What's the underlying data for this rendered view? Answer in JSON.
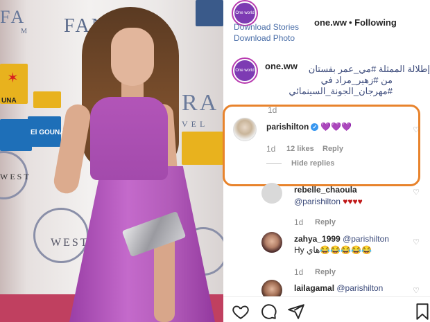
{
  "post": {
    "account": {
      "avatar_text": "One world",
      "username": "one.ww",
      "following": "• Following",
      "links": [
        "Download Stories",
        "Download Photo"
      ]
    },
    "caption": {
      "username": "one.ww",
      "text_line1": "إطلالة الممثلة #مي_عمر بفستان",
      "text_line2": "من #زهير_مراد في",
      "text_line3": "#مهرجان_الجونة_السينمائي",
      "time": "1d"
    },
    "backdrop": {
      "fan": "FANAR",
      "ma": "MA",
      "fa": "FA",
      "m": "M",
      "ra": "RA",
      "vel": "VEL",
      "west1": "WEST",
      "west2": "WEST",
      "logo_word1": "UNA",
      "logo_word2": "El GOUNA"
    }
  },
  "comments": [
    {
      "username": "parishilton",
      "verified": true,
      "text": "💜💜💜",
      "time": "1d",
      "likes": "12 likes",
      "reply": "Reply",
      "toggle": "Hide replies"
    }
  ],
  "replies": [
    {
      "username": "rebelle_chaoula",
      "mention": "@parishilton",
      "text": "♥♥♥♥",
      "time": "1d",
      "reply": "Reply"
    },
    {
      "username": "zahya_1999",
      "mention": "@parishilton",
      "text": "Hy هاي😂😂😂😂😂",
      "time": "1d",
      "reply": "Reply"
    },
    {
      "username": "lailagamal",
      "mention": "@parishilton"
    }
  ],
  "icons": {
    "heart": "heart-icon",
    "comment": "comment-icon",
    "share": "share-icon",
    "save": "bookmark-icon"
  },
  "colors": {
    "accent_link": "#3b4a7a",
    "highlight_border": "#e8832c",
    "verified": "#3897f0"
  }
}
